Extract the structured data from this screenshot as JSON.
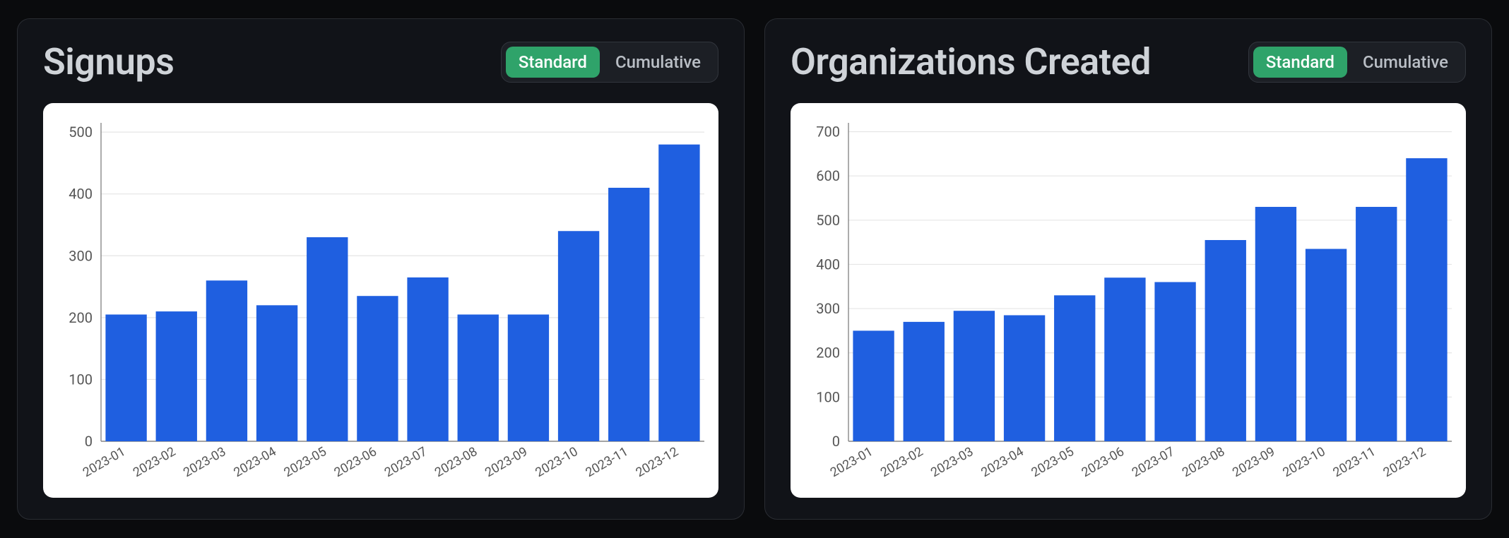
{
  "toggle_labels": {
    "standard": "Standard",
    "cumulative": "Cumulative"
  },
  "cards": [
    {
      "id": "signups",
      "title": "Signups",
      "active_toggle": "standard",
      "chart_data": {
        "type": "bar",
        "categories": [
          "2023-01",
          "2023-02",
          "2023-03",
          "2023-04",
          "2023-05",
          "2023-06",
          "2023-07",
          "2023-08",
          "2023-09",
          "2023-10",
          "2023-11",
          "2023-12"
        ],
        "values": [
          205,
          210,
          260,
          220,
          330,
          235,
          265,
          205,
          205,
          340,
          410,
          480
        ],
        "yticks": [
          0,
          100,
          200,
          300,
          400,
          500
        ],
        "ylim": [
          0,
          515
        ],
        "xlabel": "",
        "ylabel": "",
        "title": ""
      }
    },
    {
      "id": "orgs",
      "title": "Organizations Created",
      "active_toggle": "standard",
      "chart_data": {
        "type": "bar",
        "categories": [
          "2023-01",
          "2023-02",
          "2023-03",
          "2023-04",
          "2023-05",
          "2023-06",
          "2023-07",
          "2023-08",
          "2023-09",
          "2023-10",
          "2023-11",
          "2023-12"
        ],
        "values": [
          250,
          270,
          295,
          285,
          330,
          370,
          360,
          455,
          530,
          435,
          530,
          640
        ],
        "yticks": [
          0,
          100,
          200,
          300,
          400,
          500,
          600,
          700
        ],
        "ylim": [
          0,
          720
        ],
        "xlabel": "",
        "ylabel": "",
        "title": ""
      }
    }
  ],
  "chart_data": [
    {
      "type": "bar",
      "title": "Signups",
      "categories": [
        "2023-01",
        "2023-02",
        "2023-03",
        "2023-04",
        "2023-05",
        "2023-06",
        "2023-07",
        "2023-08",
        "2023-09",
        "2023-10",
        "2023-11",
        "2023-12"
      ],
      "values": [
        205,
        210,
        260,
        220,
        330,
        235,
        265,
        205,
        205,
        340,
        410,
        480
      ],
      "xlabel": "",
      "ylabel": "",
      "ylim": [
        0,
        515
      ]
    },
    {
      "type": "bar",
      "title": "Organizations Created",
      "categories": [
        "2023-01",
        "2023-02",
        "2023-03",
        "2023-04",
        "2023-05",
        "2023-06",
        "2023-07",
        "2023-08",
        "2023-09",
        "2023-10",
        "2023-11",
        "2023-12"
      ],
      "values": [
        250,
        270,
        295,
        285,
        330,
        370,
        360,
        455,
        530,
        435,
        530,
        640
      ],
      "xlabel": "",
      "ylabel": "",
      "ylim": [
        0,
        720
      ]
    }
  ]
}
